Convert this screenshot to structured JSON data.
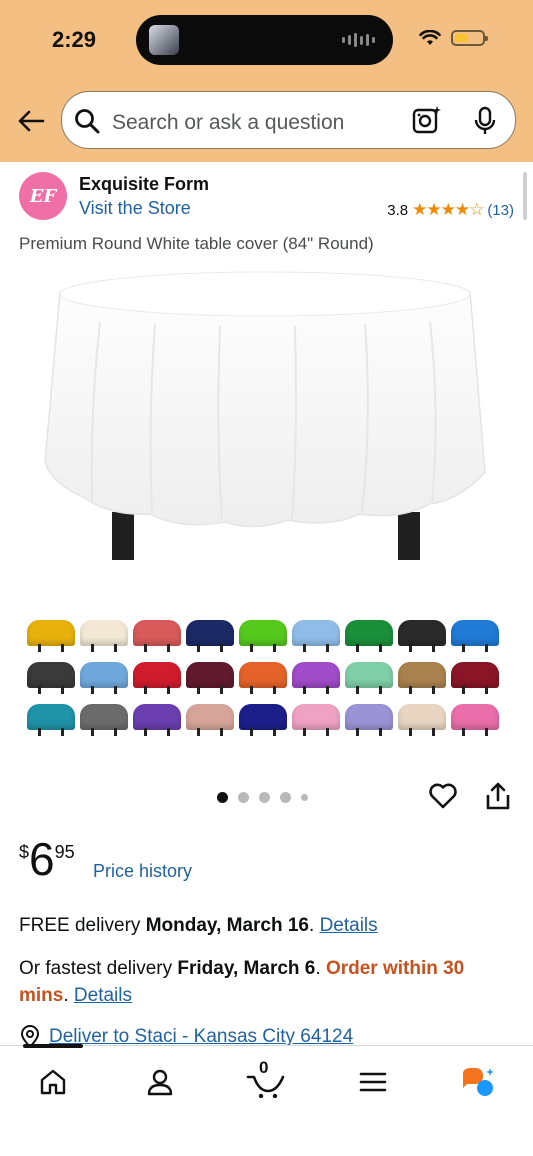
{
  "status_bar": {
    "time": "2:29",
    "icons": [
      "wifi-icon",
      "battery-icon"
    ]
  },
  "header": {
    "back_icon": "arrow-left-icon",
    "search_placeholder": "Search or ask a question",
    "search_icons": [
      "search-icon",
      "camera-icon",
      "microphone-icon"
    ]
  },
  "store": {
    "logo_text": "EF",
    "brand_name": "Exquisite Form",
    "visit_store_label": "Visit the Store",
    "rating_value": "3.8",
    "rating_stars": 3.8,
    "rating_count": "(13)"
  },
  "product": {
    "title": "Premium Round White table cover (84\" Round)",
    "image_icon": "round-tablecloth-image",
    "swatch_colors": [
      "#e8b10c",
      "#f3e8d5",
      "#d95a5a",
      "#1b2a66",
      "#56c91d",
      "#8fbde8",
      "#1a8f3a",
      "#2a2a2a",
      "#1f7bd6",
      "#3a3a3a",
      "#6fa8dc",
      "#d01c2d",
      "#611a2e",
      "#e5632a",
      "#a04bc9",
      "#7fcfa8",
      "#a9824e",
      "#8a1526",
      "#1f93a8",
      "#6c6c6c",
      "#6b3fb0",
      "#d6a59a",
      "#1c1f8a",
      "#efa3c3",
      "#9a93d6",
      "#e9d6c2",
      "#e96ea9"
    ],
    "image_count": 5,
    "image_index": 0,
    "action_icons": [
      "heart-icon",
      "share-icon"
    ]
  },
  "pricing": {
    "currency": "$",
    "whole": "6",
    "fraction": "95",
    "price_history_label": "Price history"
  },
  "delivery": {
    "free_prefix": "FREE delivery ",
    "free_date": "Monday, March 16",
    "free_details_label": "Details",
    "fast_prefix": "Or fastest delivery ",
    "fast_date": "Friday, March 6",
    "fast_cutoff": "Order within 30 mins",
    "fast_details_label": "Details",
    "deliver_to": "Deliver to Staci - Kansas City 64124",
    "accent_color": "#c7511f",
    "link_color": "#2162a1"
  },
  "bottom_nav": {
    "cart_count": "0",
    "items": [
      "home-icon",
      "account-icon",
      "cart-icon",
      "menu-icon",
      "rufus-icon"
    ]
  },
  "colors": {
    "header_bg": "#f3bf83",
    "star": "#f08804"
  }
}
